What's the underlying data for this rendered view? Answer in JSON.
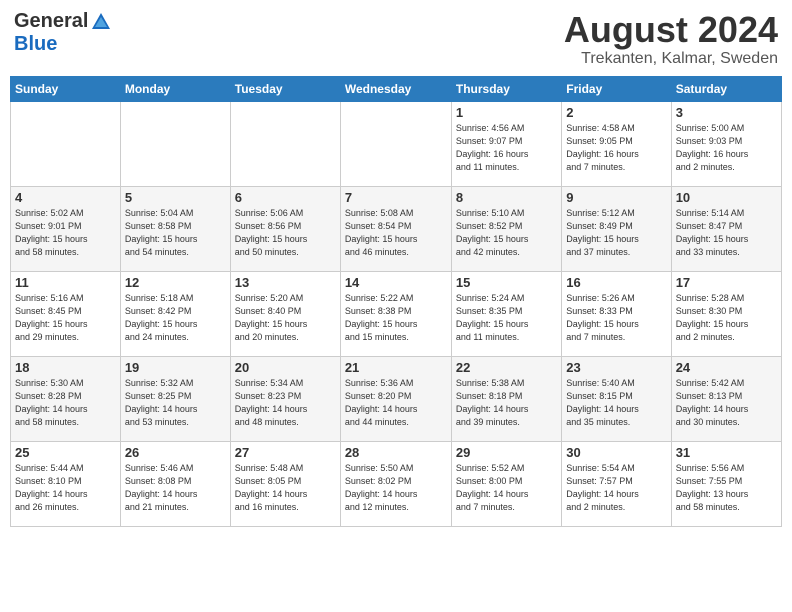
{
  "logo": {
    "general": "General",
    "blue": "Blue"
  },
  "title": "August 2024",
  "location": "Trekanten, Kalmar, Sweden",
  "days_of_week": [
    "Sunday",
    "Monday",
    "Tuesday",
    "Wednesday",
    "Thursday",
    "Friday",
    "Saturday"
  ],
  "weeks": [
    [
      {
        "day": "",
        "info": ""
      },
      {
        "day": "",
        "info": ""
      },
      {
        "day": "",
        "info": ""
      },
      {
        "day": "",
        "info": ""
      },
      {
        "day": "1",
        "info": "Sunrise: 4:56 AM\nSunset: 9:07 PM\nDaylight: 16 hours\nand 11 minutes."
      },
      {
        "day": "2",
        "info": "Sunrise: 4:58 AM\nSunset: 9:05 PM\nDaylight: 16 hours\nand 7 minutes."
      },
      {
        "day": "3",
        "info": "Sunrise: 5:00 AM\nSunset: 9:03 PM\nDaylight: 16 hours\nand 2 minutes."
      }
    ],
    [
      {
        "day": "4",
        "info": "Sunrise: 5:02 AM\nSunset: 9:01 PM\nDaylight: 15 hours\nand 58 minutes."
      },
      {
        "day": "5",
        "info": "Sunrise: 5:04 AM\nSunset: 8:58 PM\nDaylight: 15 hours\nand 54 minutes."
      },
      {
        "day": "6",
        "info": "Sunrise: 5:06 AM\nSunset: 8:56 PM\nDaylight: 15 hours\nand 50 minutes."
      },
      {
        "day": "7",
        "info": "Sunrise: 5:08 AM\nSunset: 8:54 PM\nDaylight: 15 hours\nand 46 minutes."
      },
      {
        "day": "8",
        "info": "Sunrise: 5:10 AM\nSunset: 8:52 PM\nDaylight: 15 hours\nand 42 minutes."
      },
      {
        "day": "9",
        "info": "Sunrise: 5:12 AM\nSunset: 8:49 PM\nDaylight: 15 hours\nand 37 minutes."
      },
      {
        "day": "10",
        "info": "Sunrise: 5:14 AM\nSunset: 8:47 PM\nDaylight: 15 hours\nand 33 minutes."
      }
    ],
    [
      {
        "day": "11",
        "info": "Sunrise: 5:16 AM\nSunset: 8:45 PM\nDaylight: 15 hours\nand 29 minutes."
      },
      {
        "day": "12",
        "info": "Sunrise: 5:18 AM\nSunset: 8:42 PM\nDaylight: 15 hours\nand 24 minutes."
      },
      {
        "day": "13",
        "info": "Sunrise: 5:20 AM\nSunset: 8:40 PM\nDaylight: 15 hours\nand 20 minutes."
      },
      {
        "day": "14",
        "info": "Sunrise: 5:22 AM\nSunset: 8:38 PM\nDaylight: 15 hours\nand 15 minutes."
      },
      {
        "day": "15",
        "info": "Sunrise: 5:24 AM\nSunset: 8:35 PM\nDaylight: 15 hours\nand 11 minutes."
      },
      {
        "day": "16",
        "info": "Sunrise: 5:26 AM\nSunset: 8:33 PM\nDaylight: 15 hours\nand 7 minutes."
      },
      {
        "day": "17",
        "info": "Sunrise: 5:28 AM\nSunset: 8:30 PM\nDaylight: 15 hours\nand 2 minutes."
      }
    ],
    [
      {
        "day": "18",
        "info": "Sunrise: 5:30 AM\nSunset: 8:28 PM\nDaylight: 14 hours\nand 58 minutes."
      },
      {
        "day": "19",
        "info": "Sunrise: 5:32 AM\nSunset: 8:25 PM\nDaylight: 14 hours\nand 53 minutes."
      },
      {
        "day": "20",
        "info": "Sunrise: 5:34 AM\nSunset: 8:23 PM\nDaylight: 14 hours\nand 48 minutes."
      },
      {
        "day": "21",
        "info": "Sunrise: 5:36 AM\nSunset: 8:20 PM\nDaylight: 14 hours\nand 44 minutes."
      },
      {
        "day": "22",
        "info": "Sunrise: 5:38 AM\nSunset: 8:18 PM\nDaylight: 14 hours\nand 39 minutes."
      },
      {
        "day": "23",
        "info": "Sunrise: 5:40 AM\nSunset: 8:15 PM\nDaylight: 14 hours\nand 35 minutes."
      },
      {
        "day": "24",
        "info": "Sunrise: 5:42 AM\nSunset: 8:13 PM\nDaylight: 14 hours\nand 30 minutes."
      }
    ],
    [
      {
        "day": "25",
        "info": "Sunrise: 5:44 AM\nSunset: 8:10 PM\nDaylight: 14 hours\nand 26 minutes."
      },
      {
        "day": "26",
        "info": "Sunrise: 5:46 AM\nSunset: 8:08 PM\nDaylight: 14 hours\nand 21 minutes."
      },
      {
        "day": "27",
        "info": "Sunrise: 5:48 AM\nSunset: 8:05 PM\nDaylight: 14 hours\nand 16 minutes."
      },
      {
        "day": "28",
        "info": "Sunrise: 5:50 AM\nSunset: 8:02 PM\nDaylight: 14 hours\nand 12 minutes."
      },
      {
        "day": "29",
        "info": "Sunrise: 5:52 AM\nSunset: 8:00 PM\nDaylight: 14 hours\nand 7 minutes."
      },
      {
        "day": "30",
        "info": "Sunrise: 5:54 AM\nSunset: 7:57 PM\nDaylight: 14 hours\nand 2 minutes."
      },
      {
        "day": "31",
        "info": "Sunrise: 5:56 AM\nSunset: 7:55 PM\nDaylight: 13 hours\nand 58 minutes."
      }
    ]
  ]
}
